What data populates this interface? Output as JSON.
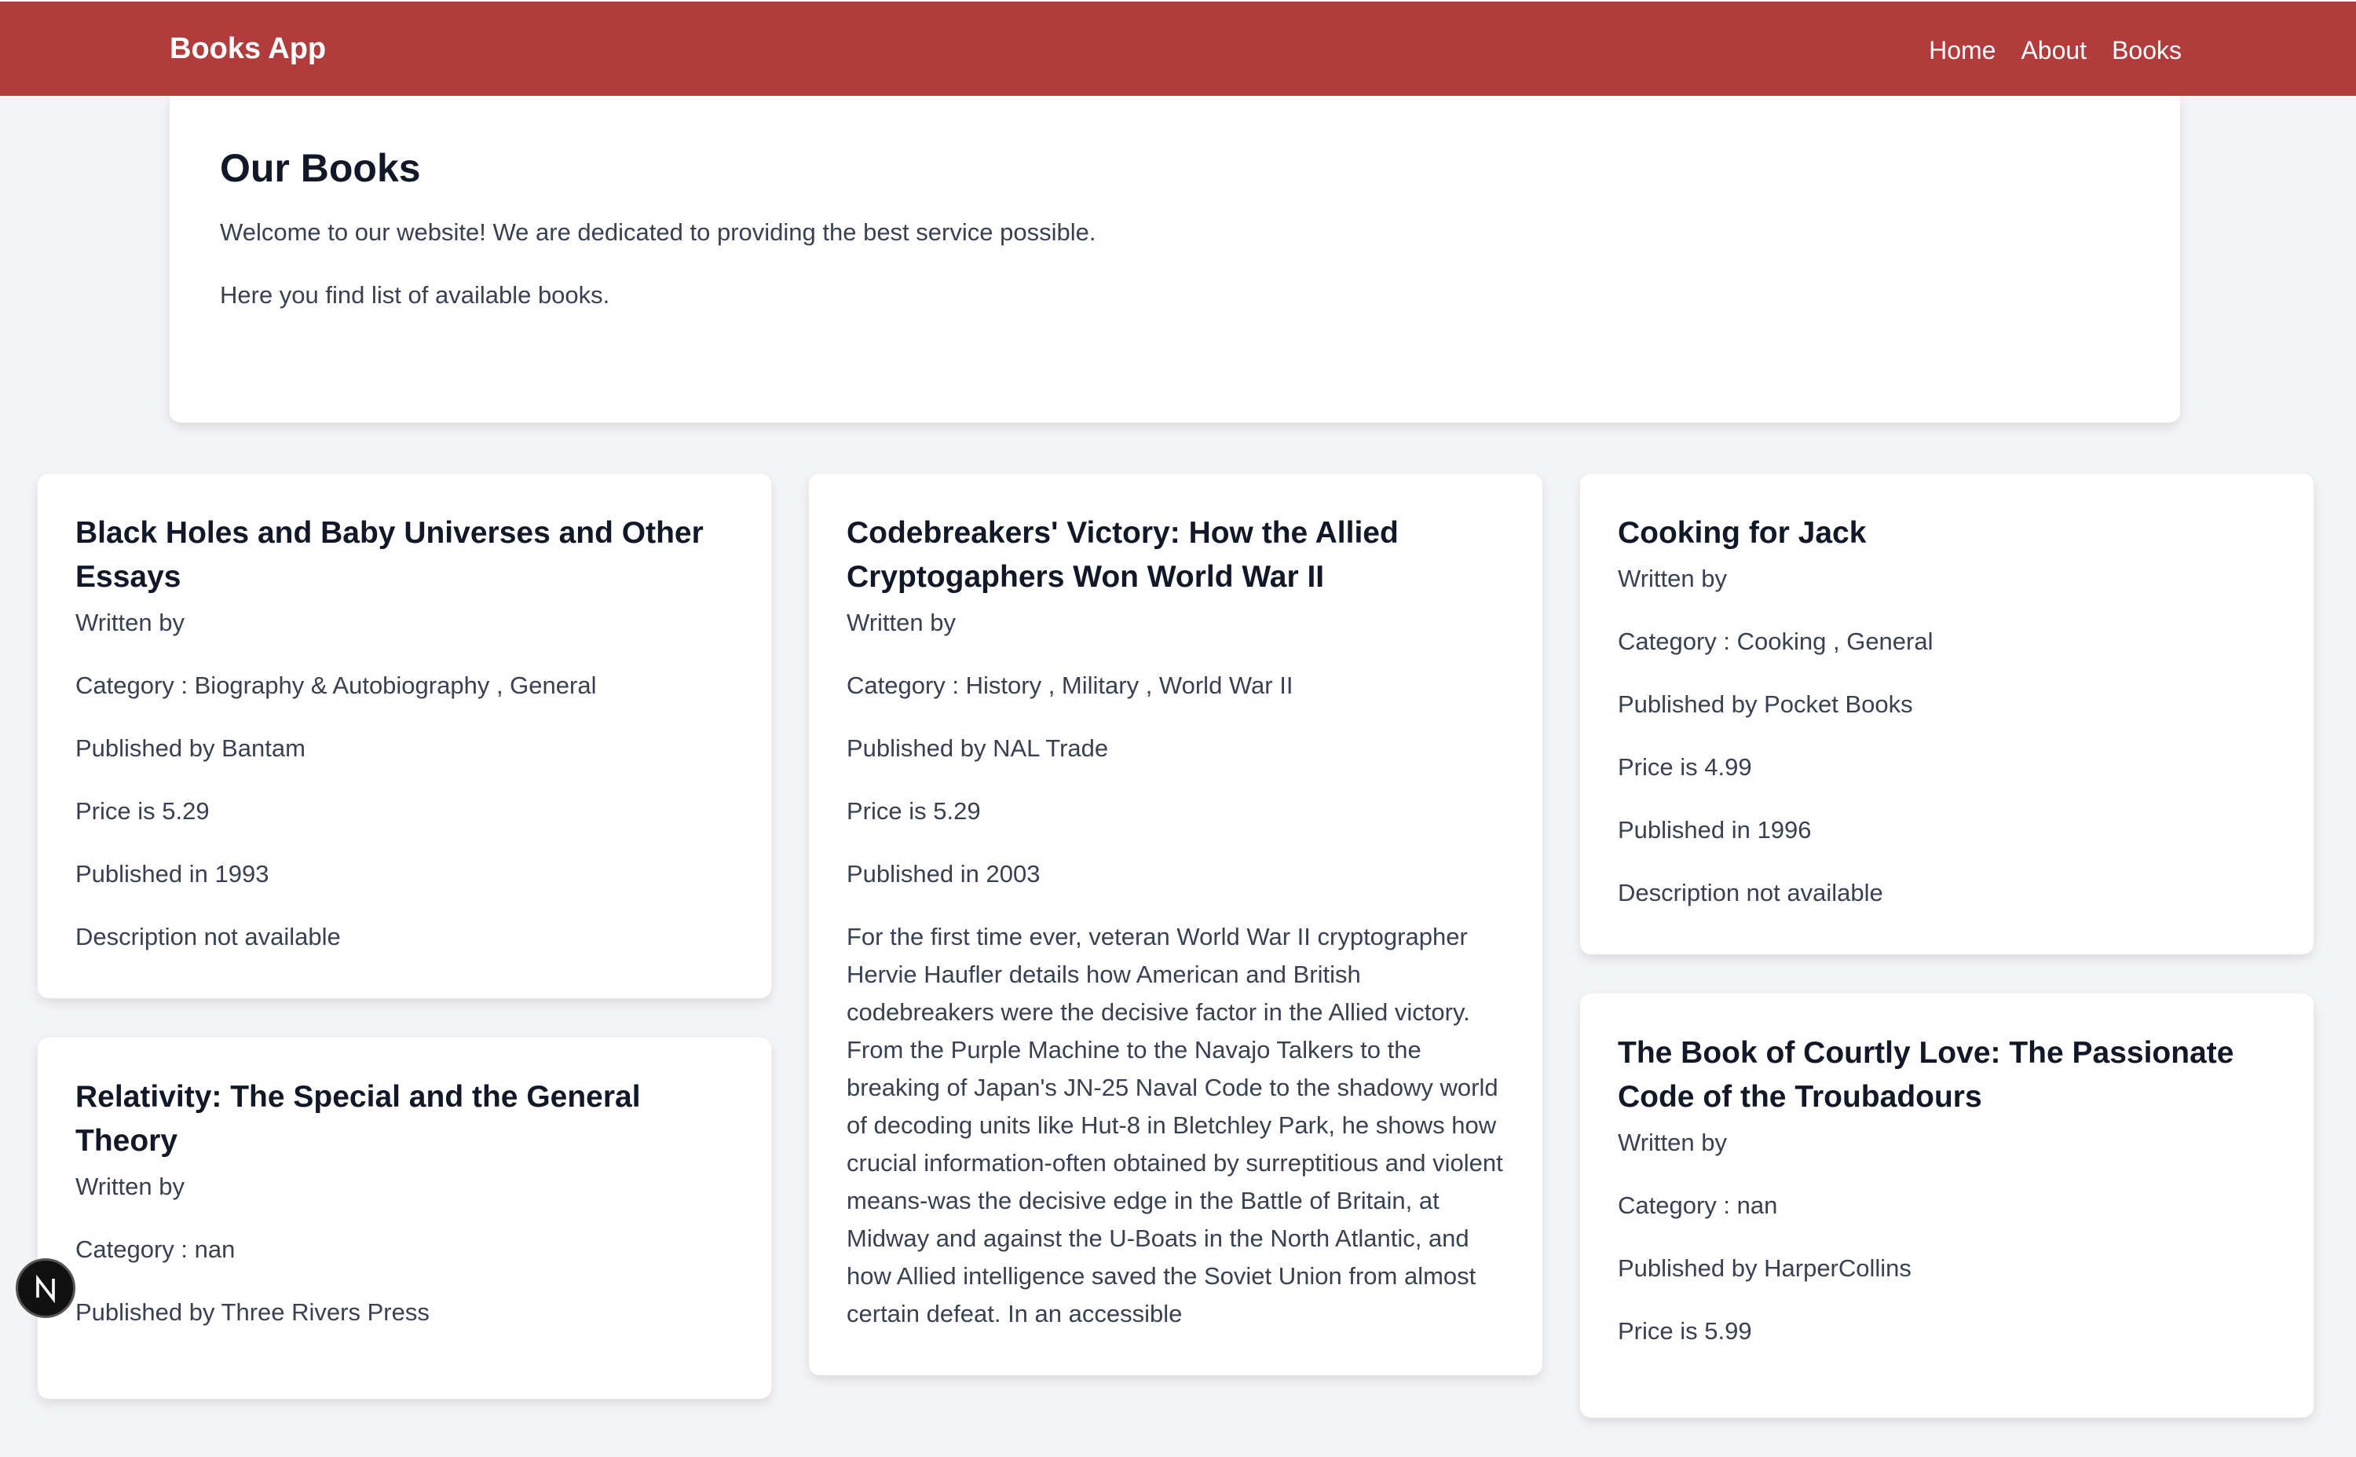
{
  "navbar": {
    "brand": "Books App",
    "links": [
      "Home",
      "About",
      "Books"
    ]
  },
  "intro": {
    "title": "Our Books",
    "line1": "Welcome to our website! We are dedicated to providing the best service possible.",
    "line2": "Here you find list of available books."
  },
  "books": [
    {
      "title": "Black Holes and Baby Universes and Other Essays",
      "author": "Written by",
      "category": "Category : Biography & Autobiography , General",
      "publisher": "Published by Bantam",
      "price": "Price is 5.29",
      "year": "Published in 1993",
      "description": "Description not available"
    },
    {
      "title": "Relativity: The Special and the General Theory",
      "author": "Written by",
      "category": "Category : nan",
      "publisher": "Published by Three Rivers Press"
    },
    {
      "title": "Codebreakers' Victory: How the Allied Cryptogaphers Won World War II",
      "author": "Written by",
      "category": "Category : History , Military , World War II",
      "publisher": "Published by NAL Trade",
      "price": "Price is 5.29",
      "year": "Published in 2003",
      "description": "For the first time ever, veteran World War II cryptographer Hervie Haufler details how American and British codebreakers were the decisive factor in the Allied victory. From the Purple Machine to the Navajo Talkers to the breaking of Japan's JN-25 Naval Code to the shadowy world of decoding units like Hut-8 in Bletchley Park, he shows how crucial information-often obtained by surreptitious and violent means-was the decisive edge in the Battle of Britain, at Midway and against the U-Boats in the North Atlantic, and how Allied intelligence saved the Soviet Union from almost certain defeat. In an accessible"
    },
    {
      "title": "Cooking for Jack",
      "author": "Written by",
      "category": "Category : Cooking , General",
      "publisher": "Published by Pocket Books",
      "price": "Price is 4.99",
      "year": "Published in 1996",
      "description": "Description not available"
    },
    {
      "title": "The Book of Courtly Love: The Passionate Code of the Troubadours",
      "author": "Written by",
      "category": "Category : nan",
      "publisher": "Published by HarperCollins",
      "price": "Price is 5.99"
    }
  ],
  "devtools": {
    "badge_icon": "nextjs-icon",
    "badge_letter": "N"
  },
  "colors": {
    "navbar": "#b13c3b",
    "background": "#f3f4f6",
    "card": "#ffffff"
  }
}
